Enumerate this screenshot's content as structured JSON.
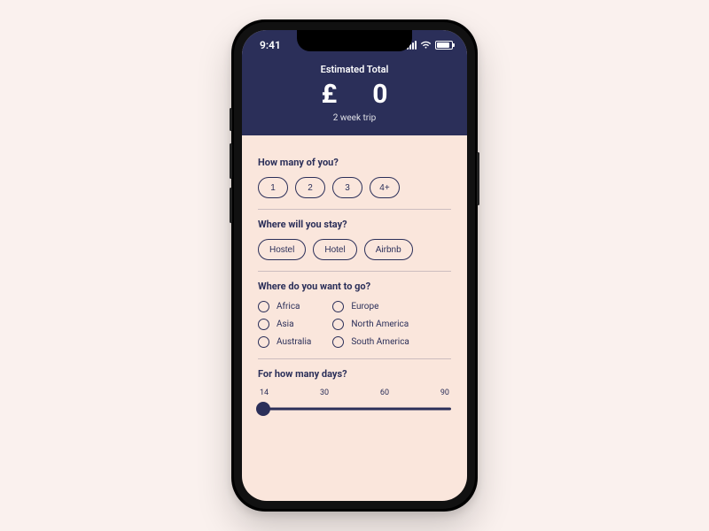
{
  "status": {
    "time": "9:41"
  },
  "header": {
    "title": "Estimated Total",
    "currency": "£",
    "total": "0",
    "subtitle": "2 week trip"
  },
  "people": {
    "question": "How many of you?",
    "options": [
      "1",
      "2",
      "3",
      "4+"
    ]
  },
  "stay": {
    "question": "Where will you stay?",
    "options": [
      "Hostel",
      "Hotel",
      "Airbnb"
    ]
  },
  "go": {
    "question": "Where do you want to go?",
    "left": [
      "Africa",
      "Asia",
      "Australia"
    ],
    "right": [
      "Europe",
      "North America",
      "South America"
    ]
  },
  "days": {
    "question": "For how many days?",
    "ticks": [
      "14",
      "30",
      "60",
      "90"
    ],
    "value": 14,
    "min": 14,
    "max": 90
  },
  "colors": {
    "brand": "#2b2f59",
    "surface": "#fae6dc",
    "page": "#faf1ee"
  }
}
